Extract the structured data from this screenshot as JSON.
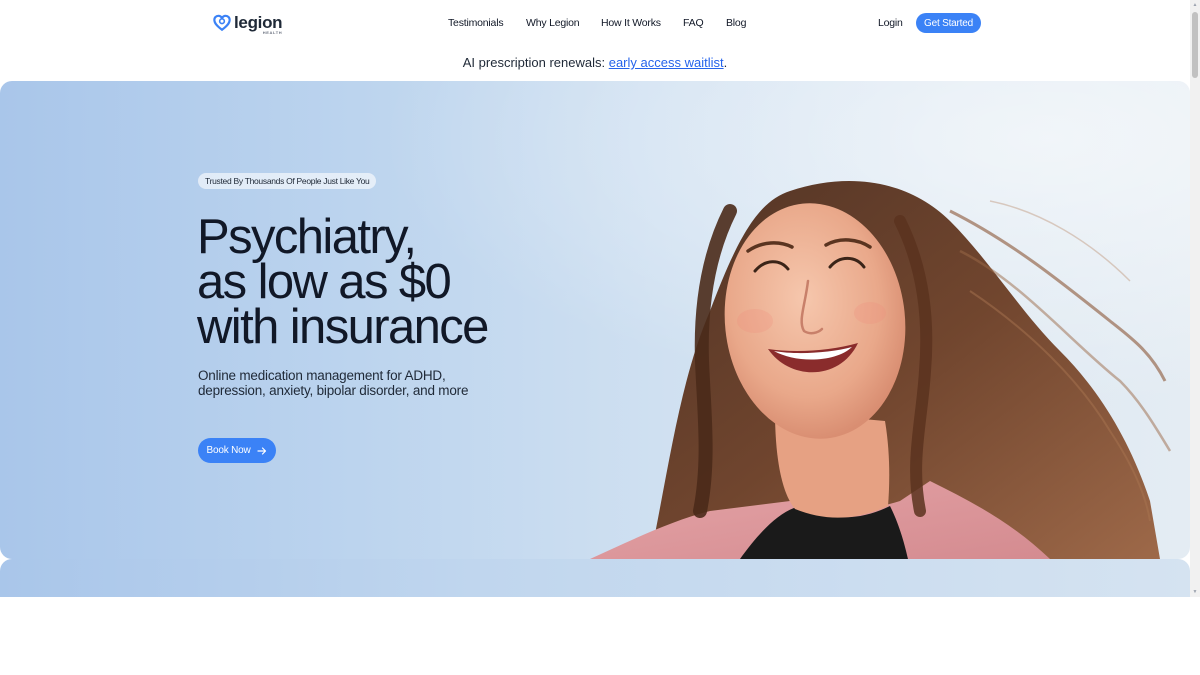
{
  "brand": {
    "name": "legion",
    "sub": "HEALTH",
    "color": "#3b82f6"
  },
  "nav": {
    "links": [
      "Testimonials",
      "Why Legion",
      "How It Works",
      "FAQ",
      "Blog"
    ],
    "login": "Login",
    "cta": "Get Started"
  },
  "announcement": {
    "prefix": "AI prescription renewals: ",
    "link": "early access waitlist",
    "suffix": "."
  },
  "hero": {
    "badge": "Trusted By Thousands Of People Just Like You",
    "headline": [
      "Psychiatry,",
      "as low as $0",
      "with insurance"
    ],
    "subtext": "Online medication management for ADHD, depression, anxiety, bipolar disorder, and more",
    "button": "Book Now",
    "button_icon": "arrow-right-icon",
    "image": "smiling-woman-portrait"
  },
  "colors": {
    "accent": "#3b82f6",
    "link": "#2563eb",
    "hero_bg": "#bcd4ee"
  }
}
